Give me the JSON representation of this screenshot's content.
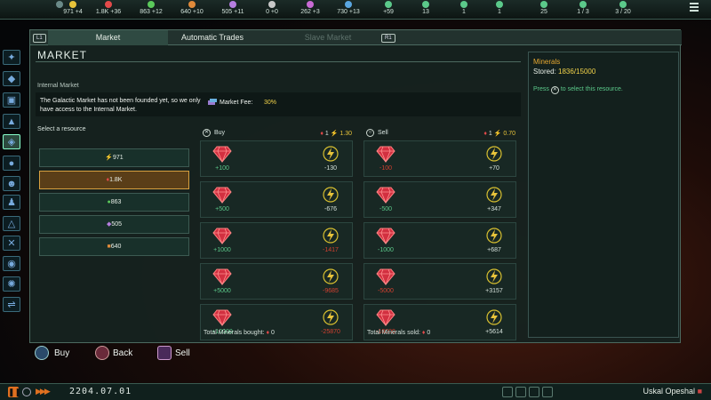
{
  "top_bar": {
    "resources": [
      {
        "name": "energy",
        "value": "971 +4",
        "color": "#e7c33a"
      },
      {
        "name": "minerals",
        "value": "1.8K +36",
        "color": "#e24a4a"
      },
      {
        "name": "food",
        "value": "863 +12",
        "color": "#5bc95b"
      },
      {
        "name": "consumer-goods",
        "value": "640 +10",
        "color": "#e08a3a"
      },
      {
        "name": "alloys",
        "value": "505 +11",
        "color": "#b67ee0"
      },
      {
        "name": "influence",
        "value": "0 +0",
        "color": "#c8c8c8"
      },
      {
        "name": "unity",
        "value": "262 +3",
        "color": "#c86ad4"
      },
      {
        "name": "research",
        "value": "730 +13",
        "color": "#5aa6e0"
      },
      {
        "name": "amenities",
        "value": "+59",
        "color": "#5bc98a"
      },
      {
        "name": "naval-capacity",
        "value": "13",
        "color": "#5bc98a"
      },
      {
        "name": "starbases",
        "value": "1",
        "color": "#5bc98a"
      },
      {
        "name": "colonies",
        "value": "1",
        "color": "#5bc98a"
      },
      {
        "name": "pops",
        "value": "25",
        "color": "#5bc98a"
      },
      {
        "name": "systems",
        "value": "1 / 3",
        "color": "#5bc98a"
      },
      {
        "name": "fleets",
        "value": "3 / 20",
        "color": "#5bc98a"
      }
    ]
  },
  "tabs": {
    "left_bumper": "L1",
    "right_bumper": "R1",
    "market": "Market",
    "automatic_trades": "Automatic Trades",
    "slave_market": "Slave Market"
  },
  "market": {
    "title": "Market",
    "subtitle": "Internal Market",
    "info": "The Galactic Market has not been founded yet, so we only have access to the Internal Market.",
    "fee_label": "Market Fee:",
    "fee_value": "30%",
    "select_label": "Select a resource",
    "resources": [
      {
        "label": "971",
        "icon": "energy-icon",
        "selected": false
      },
      {
        "label": "1.8K",
        "icon": "minerals-icon",
        "selected": true
      },
      {
        "label": "863",
        "icon": "food-icon",
        "selected": false
      },
      {
        "label": "505",
        "icon": "alloys-icon",
        "selected": false
      },
      {
        "label": "640",
        "icon": "consumer-goods-icon",
        "selected": false
      }
    ],
    "buy": {
      "label": "Buy",
      "rate_left": "1",
      "rate_right": "1.30",
      "rows": [
        {
          "amount": "+100",
          "cost": "-130",
          "cost_state": "plain"
        },
        {
          "amount": "+500",
          "cost": "-676",
          "cost_state": "plain"
        },
        {
          "amount": "+1000",
          "cost": "-1417",
          "cost_state": "red"
        },
        {
          "amount": "+5000",
          "cost": "-9685",
          "cost_state": "red"
        },
        {
          "amount": "+10000",
          "cost": "-25870",
          "cost_state": "red"
        }
      ],
      "total_label": "Total Minerals bought:",
      "total_value": "0"
    },
    "sell": {
      "label": "Sell",
      "rate_left": "1",
      "rate_right": "0.70",
      "rows": [
        {
          "amount": "-100",
          "gain": "+70",
          "amount_state": "red"
        },
        {
          "amount": "-500",
          "gain": "+347",
          "amount_state": "green"
        },
        {
          "amount": "-1000",
          "gain": "+687",
          "amount_state": "green"
        },
        {
          "amount": "-5000",
          "gain": "+3157",
          "amount_state": "red"
        },
        {
          "amount": "-10000",
          "gain": "+5614",
          "amount_state": "red"
        }
      ],
      "total_label": "Total Minerals sold:",
      "total_value": "0"
    }
  },
  "detail": {
    "name": "Minerals",
    "stored_label": "Stored:",
    "stored_value": "1836/15000",
    "press": "Press",
    "press_suffix": "to select this resource."
  },
  "buttons": {
    "buy": "Buy",
    "back": "Back",
    "sell": "Sell"
  },
  "bottom_bar": {
    "date": "2204.07.01",
    "player": "Uskal Opeshal"
  }
}
